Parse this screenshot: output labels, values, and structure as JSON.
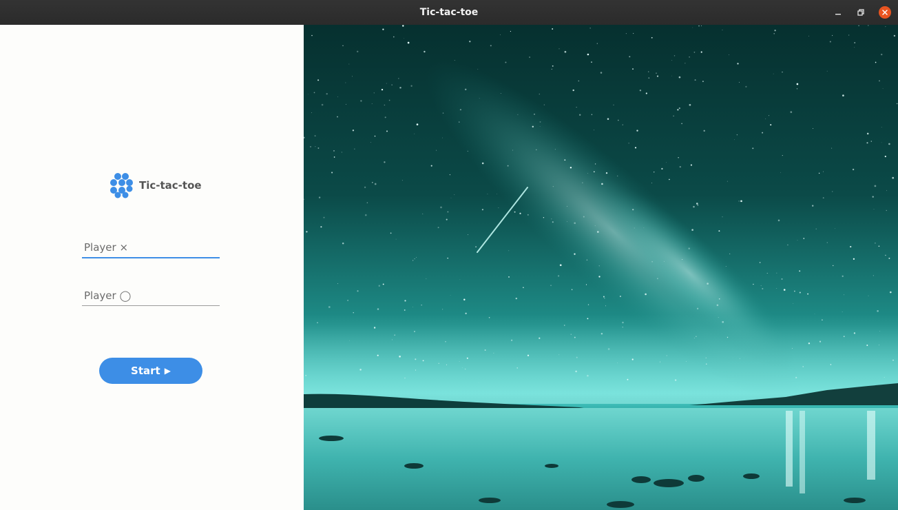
{
  "window": {
    "title": "Tic-tac-toe",
    "controls": {
      "minimize": "minimize-icon",
      "maximize": "maximize-icon",
      "close": "close-icon"
    }
  },
  "brand": {
    "name": "Tic-tac-toe",
    "icon": "hexagon-cluster-icon",
    "icon_color": "#3d8ee6"
  },
  "form": {
    "player_x": {
      "placeholder": "Player ×",
      "value": ""
    },
    "player_o": {
      "placeholder": "Player ◯",
      "value": ""
    },
    "start_label": "Start",
    "start_icon": "▶"
  },
  "colors": {
    "accent": "#3d8ee6",
    "close": "#e95420",
    "sky": "#1f8f8a"
  },
  "background_image": "starry-sky-icon"
}
